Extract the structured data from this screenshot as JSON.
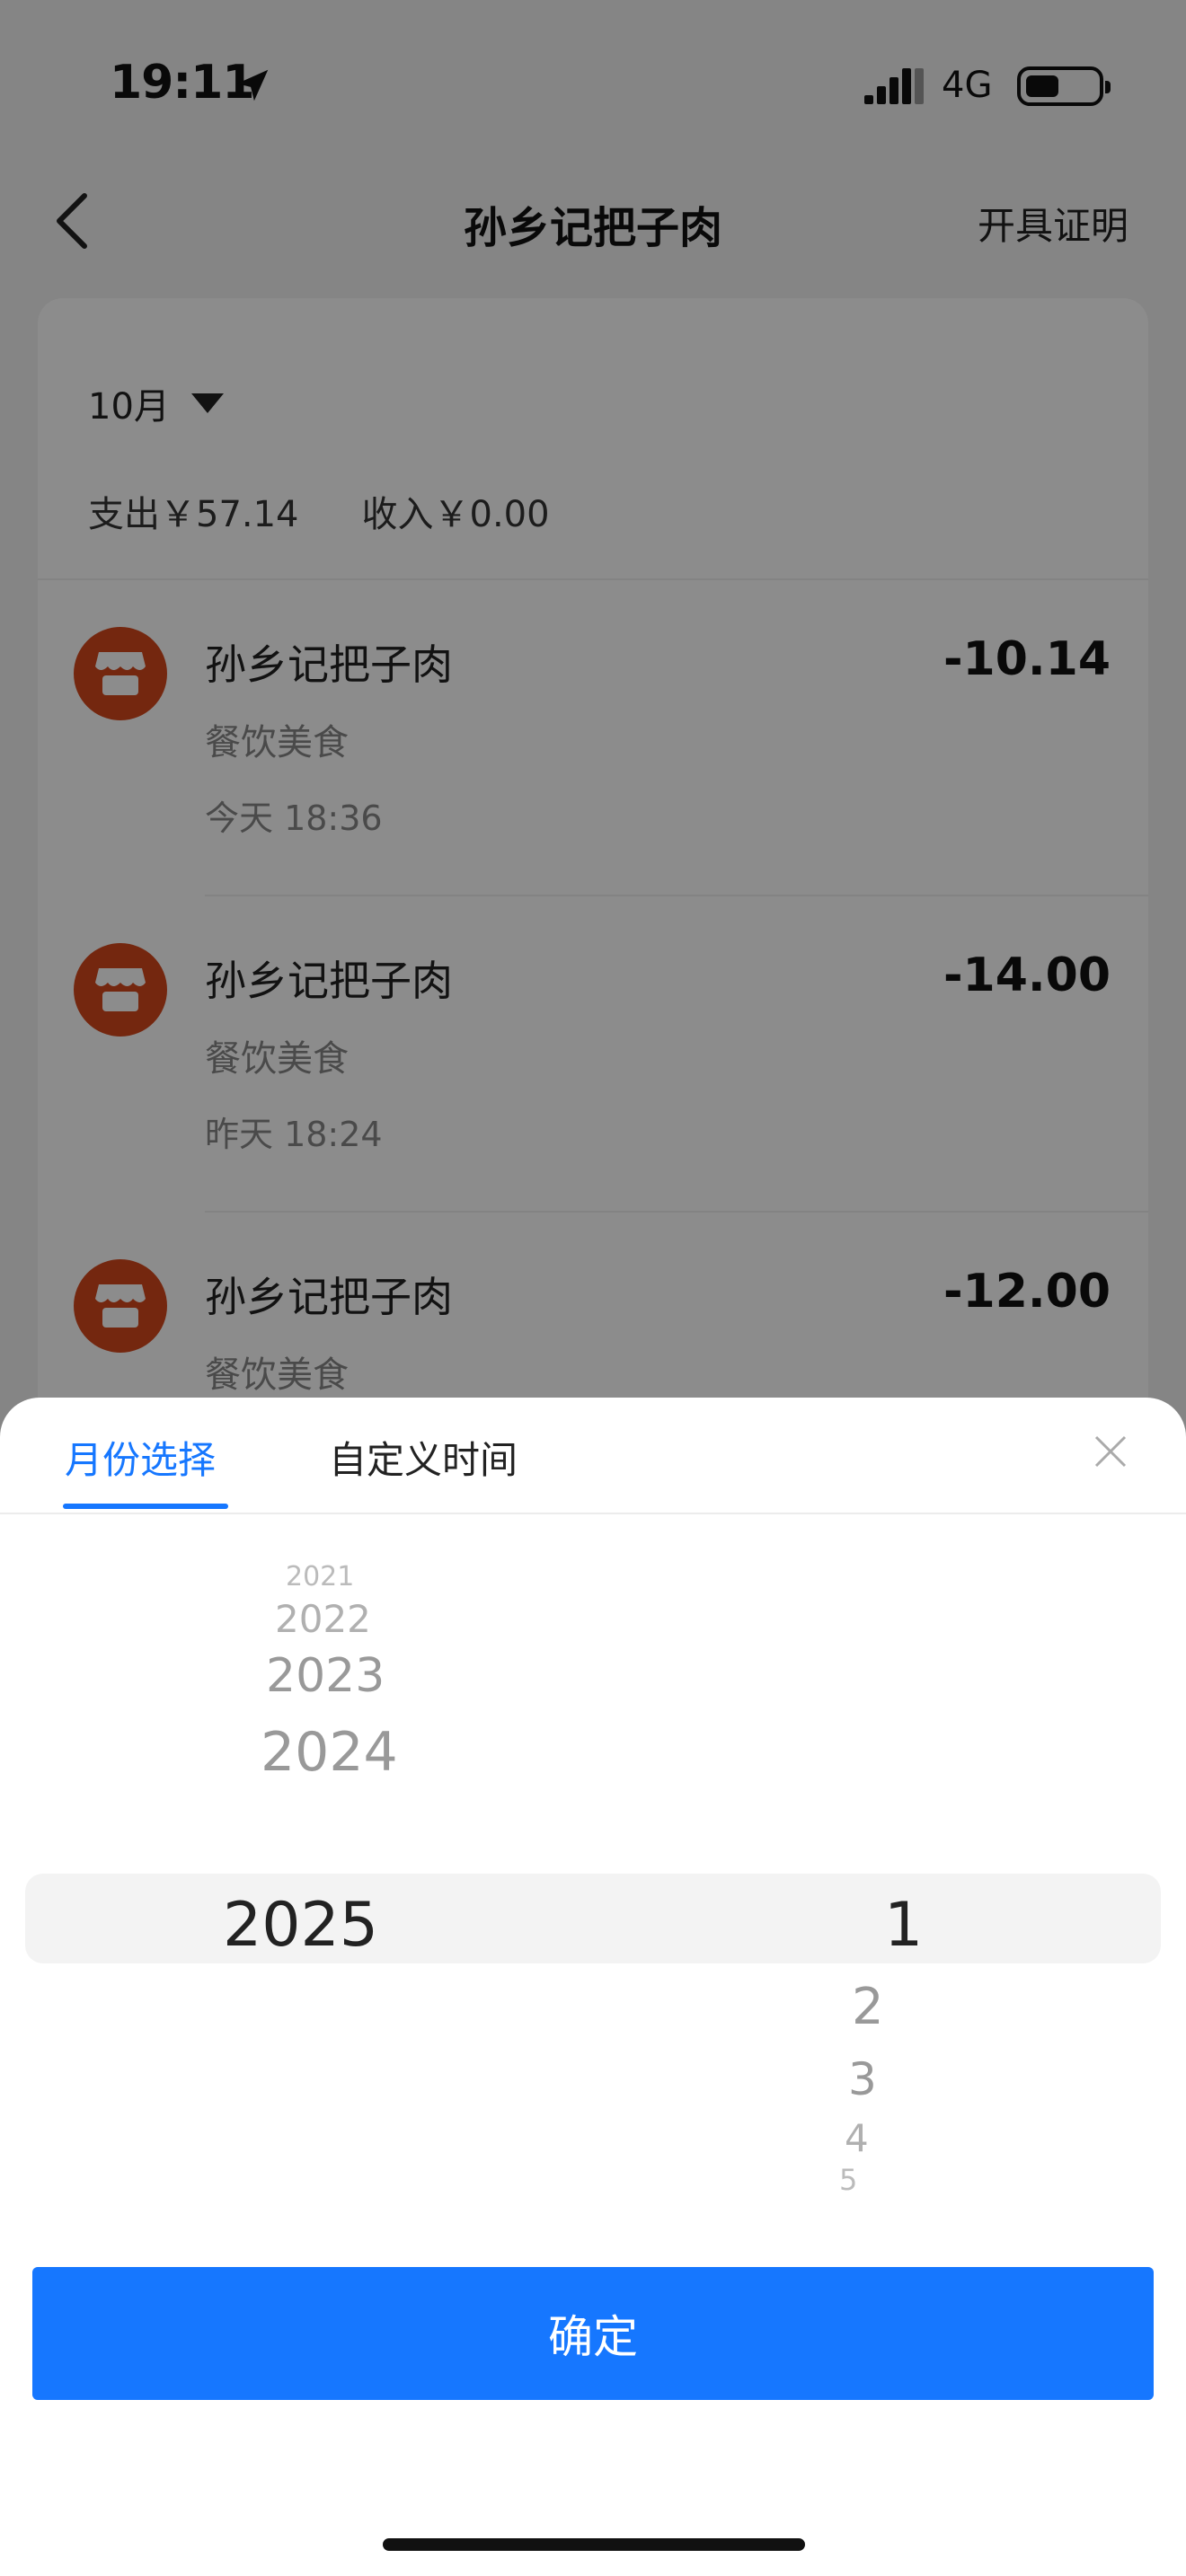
{
  "status_bar": {
    "time": "19:11",
    "network": "4G"
  },
  "nav": {
    "title": "孙乡记把子肉",
    "action": "开具证明"
  },
  "summary": {
    "month": "10月",
    "expense": "支出￥57.14",
    "income": "收入￥0.00"
  },
  "transactions": [
    {
      "name": "孙乡记把子肉",
      "category": "餐饮美食",
      "time": "今天 18:36",
      "amount": "-10.14"
    },
    {
      "name": "孙乡记把子肉",
      "category": "餐饮美食",
      "time": "昨天 18:24",
      "amount": "-14.00"
    },
    {
      "name": "孙乡记把子肉",
      "category": "餐饮美食",
      "time": "",
      "amount": "-12.00"
    }
  ],
  "sheet": {
    "tabs": [
      {
        "label": "月份选择"
      },
      {
        "label": "自定义时间"
      }
    ],
    "active_tab": "月份选择",
    "years": [
      "2021",
      "2022",
      "2023",
      "2024",
      "2025"
    ],
    "selected_year": "2025",
    "months": [
      "1",
      "2",
      "3",
      "4",
      "5"
    ],
    "selected_month": "1",
    "confirm_label": "确定"
  },
  "colors": {
    "accent": "#1677ff",
    "avatar": "#d4471d"
  }
}
